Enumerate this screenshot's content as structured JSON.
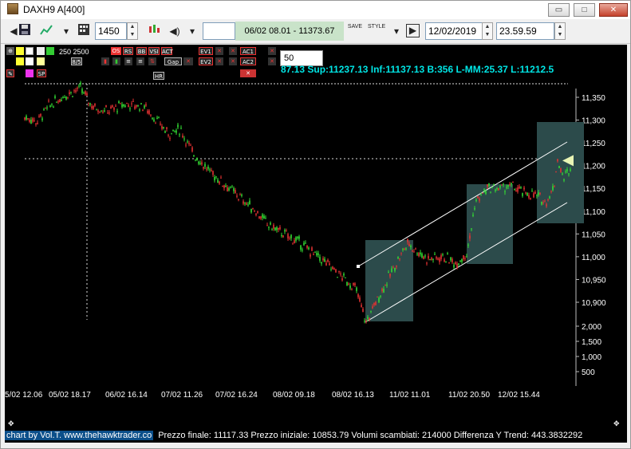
{
  "window": {
    "title": "DAXH9 A[400]",
    "min_label": "▭",
    "max_label": "□",
    "close_label": "✕"
  },
  "toolbar": {
    "bars_value": "1450",
    "status": "06/02 08.01 - 11373.67",
    "save_label": "SAVE",
    "style_label": "STYLE",
    "date_value": "12/02/2019",
    "time_value": "23.59.59"
  },
  "palette": {
    "ma_label": "250 2500",
    "period_value": "50",
    "buttons": [
      "OS",
      "RS",
      "BB",
      "VSI",
      "ACT",
      "EV1",
      "AC1",
      "8/5",
      "Gap",
      "EV2",
      "AC2",
      "HR",
      "SP"
    ]
  },
  "info_line": "87.13 Sup:11237.13 Inf:11137.13 B:356 L-MM:25.37 L:11212.5",
  "chart_data": {
    "type": "candlestick",
    "price_axis": [
      "11,350",
      "11,300",
      "11,250",
      "11,200",
      "11,150",
      "11,100",
      "11,050",
      "11,000",
      "10,950",
      "10,900"
    ],
    "volume_axis": [
      "2,000",
      "1,500",
      "1,000",
      "500"
    ],
    "x_labels": [
      "5/02 12.06",
      "05/02 18.17",
      "06/02 16.14",
      "07/02 11.26",
      "07/02 16.24",
      "08/02 09.18",
      "08/02 16.13",
      "11/02 11.01",
      "11/02 20.50",
      "12/02 15.44"
    ],
    "series_points": [
      [
        30,
        11305
      ],
      [
        40,
        11296
      ],
      [
        55,
        11330
      ],
      [
        75,
        11355
      ],
      [
        95,
        11370
      ],
      [
        110,
        11330
      ],
      [
        130,
        11320
      ],
      [
        150,
        11335
      ],
      [
        175,
        11330
      ],
      [
        190,
        11300
      ],
      [
        205,
        11270
      ],
      [
        220,
        11280
      ],
      [
        235,
        11230
      ],
      [
        255,
        11190
      ],
      [
        275,
        11160
      ],
      [
        295,
        11130
      ],
      [
        315,
        11100
      ],
      [
        330,
        11070
      ],
      [
        350,
        11050
      ],
      [
        370,
        11030
      ],
      [
        385,
        11010
      ],
      [
        400,
        10990
      ],
      [
        420,
        10960
      ],
      [
        440,
        10930
      ],
      [
        453,
        10855
      ],
      [
        465,
        10900
      ],
      [
        480,
        10950
      ],
      [
        495,
        11000
      ],
      [
        505,
        11030
      ],
      [
        515,
        11015
      ],
      [
        530,
        10995
      ],
      [
        550,
        11000
      ],
      [
        565,
        10985
      ],
      [
        580,
        11010
      ],
      [
        590,
        11120
      ],
      [
        605,
        11150
      ],
      [
        620,
        11150
      ],
      [
        635,
        11155
      ],
      [
        650,
        11140
      ],
      [
        665,
        11135
      ],
      [
        678,
        11120
      ],
      [
        688,
        11150
      ],
      [
        693,
        11215
      ],
      [
        700,
        11170
      ],
      [
        710,
        11200
      ],
      [
        717,
        11213
      ]
    ],
    "trend_marker_price": 11211
  },
  "footer": {
    "credit": "chart by Vol.T. www.thehawktrader.co",
    "stats": "Prezzo finale: 11117.33 Prezzo iniziale: 10853.79 Volumi scambiati: 214000 Differenza Y Trend: 443.3832292"
  },
  "colors": {
    "background": "#000000",
    "up": "#33dd33",
    "down": "#e63232",
    "box": "#2c4b4b",
    "info": "#00e5e5"
  }
}
